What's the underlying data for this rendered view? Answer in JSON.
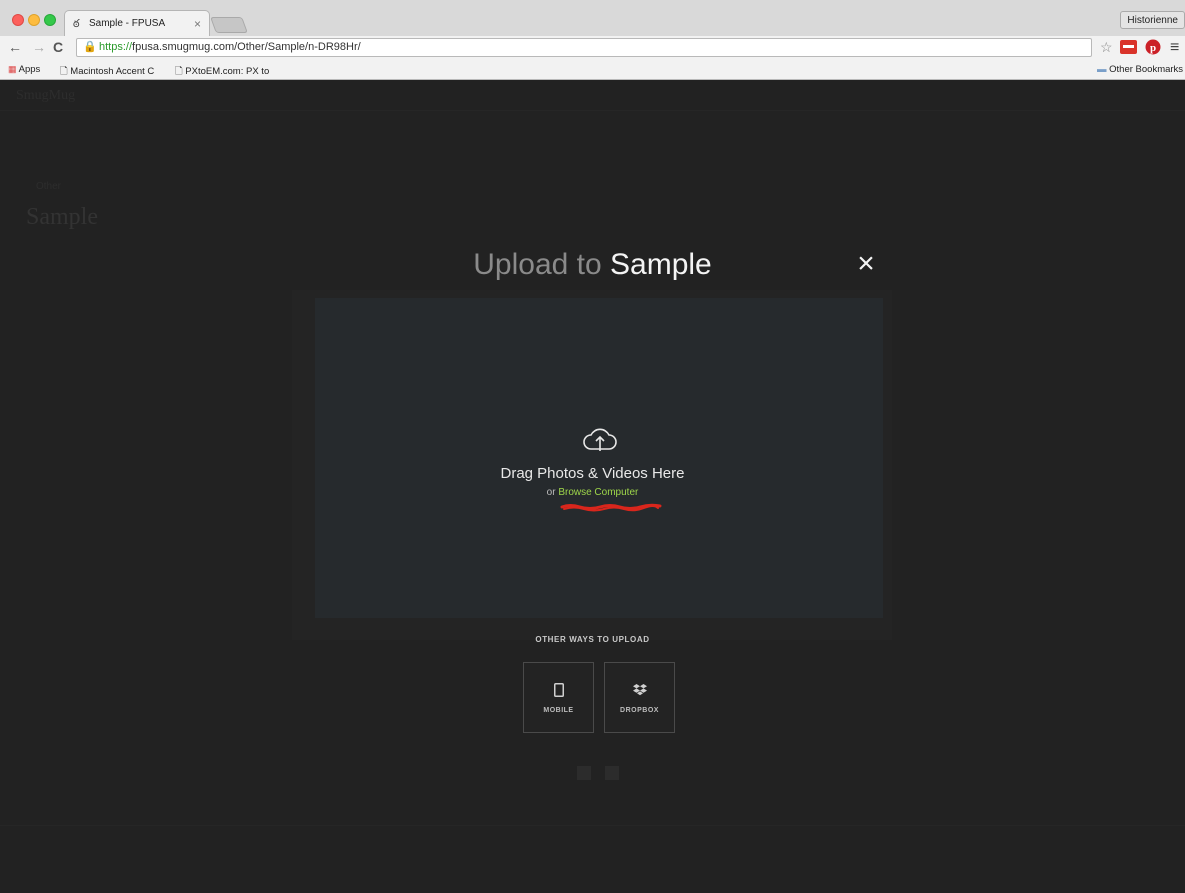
{
  "browser": {
    "tab_title": "Sample - FPUSA",
    "tab_close": "×",
    "profile_name": "Historienne",
    "url_scheme": "https://",
    "url_rest": "fpusa.smugmug.com/Other/Sample/n-DR98Hr/",
    "bookmarks": {
      "apps": "Apps",
      "item1": "Macintosh Accent C",
      "item2": "PXtoEM.com: PX to",
      "other": "Other Bookmarks"
    }
  },
  "modal": {
    "title_prefix": "Upload to ",
    "title_album": "Sample",
    "close_symbol": "×",
    "drag_text": "Drag Photos & Videos Here",
    "or_text": "or ",
    "browse_link": "Browse Computer",
    "other_ways_heading": "OTHER WAYS TO UPLOAD",
    "options": {
      "mobile_label": "MOBILE",
      "dropbox_label": "DROPBOX"
    },
    "colors": {
      "link": "#9ed64a",
      "title_dim": "#8a8a8a",
      "title_bright": "#f4f4f4",
      "annotation": "#d9261c"
    }
  },
  "background_page": {
    "logo": "SmugMug",
    "breadcrumb": "Other",
    "page_title": "Sample"
  }
}
